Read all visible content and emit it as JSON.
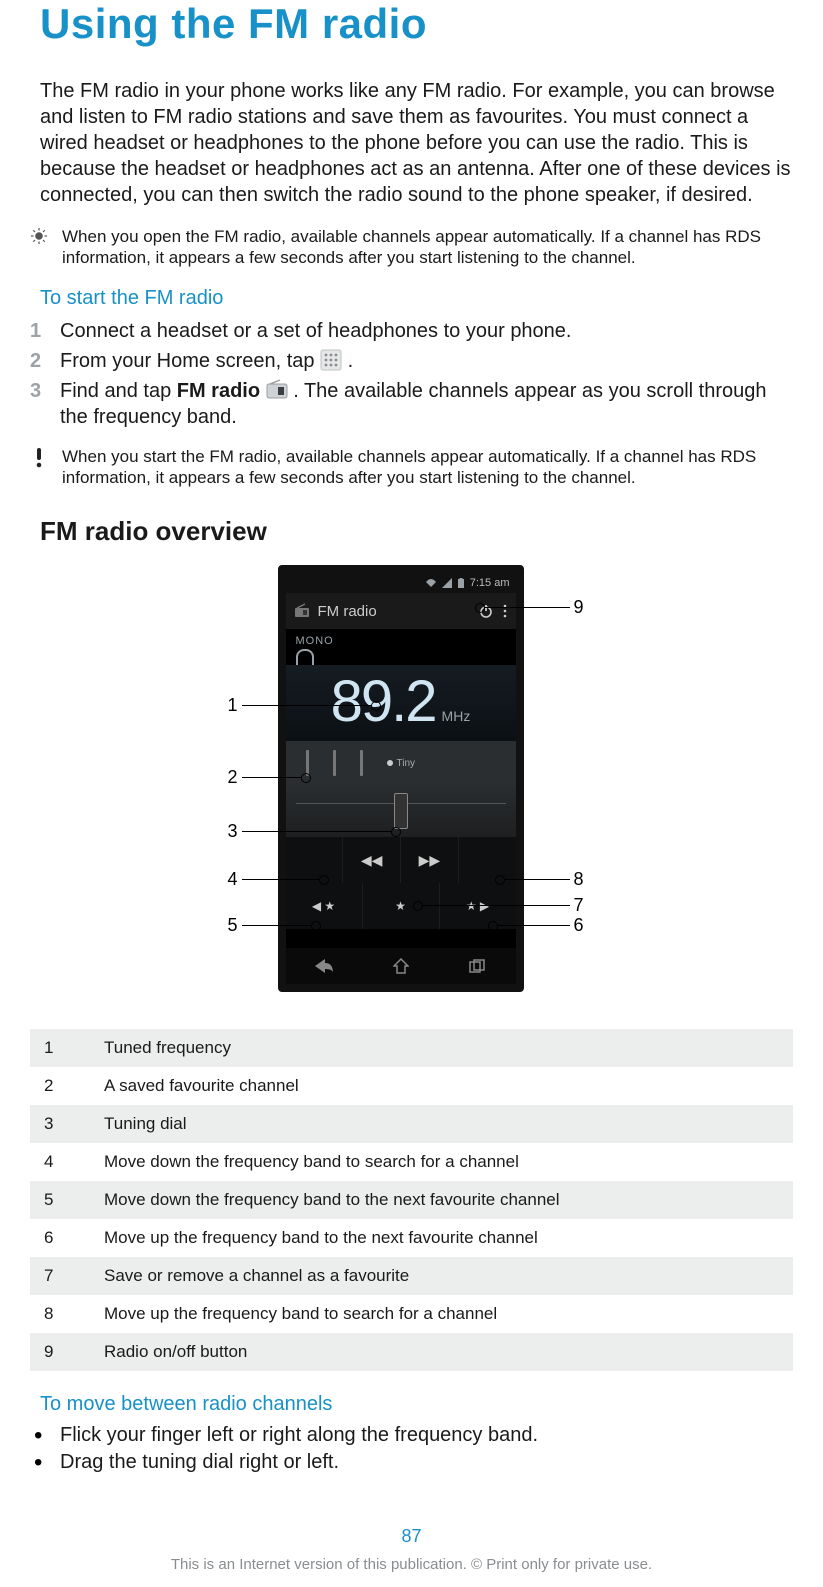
{
  "title": "Using the FM radio",
  "intro": "The FM radio in your phone works like any FM radio. For example, you can browse and listen to FM radio stations and save them as favourites. You must connect a wired headset or headphones to the phone before you can use the radio. This is because the headset or headphones act as an antenna. After one of these devices is connected, you can then switch the radio sound to the phone speaker, if desired.",
  "tip": "When you open the FM radio, available channels appear automatically. If a channel has RDS information, it appears a few seconds after you start listening to the channel.",
  "start_heading": "To start the FM radio",
  "steps": {
    "s1": "Connect a headset or a set of headphones to your phone.",
    "s2_a": "From your Home screen, tap ",
    "s2_b": " .",
    "s3_a": "Find and tap ",
    "s3_bold": "FM radio",
    "s3_b": " . The available channels appear as you scroll through the frequency band."
  },
  "important": "When you start the FM radio, available channels appear automatically. If a channel has RDS information, it appears a few seconds after you start listening to the channel.",
  "overview_heading": "FM radio overview",
  "phone": {
    "time": "7:15 am",
    "app_title": "FM radio",
    "mono": "MONO",
    "frequency": "89.2",
    "unit": "MHz",
    "fav_label": "Tiny"
  },
  "callouts": {
    "1": "1",
    "2": "2",
    "3": "3",
    "4": "4",
    "5": "5",
    "6": "6",
    "7": "7",
    "8": "8",
    "9": "9"
  },
  "overview_table": [
    {
      "n": "1",
      "t": "Tuned frequency"
    },
    {
      "n": "2",
      "t": "A saved favourite channel"
    },
    {
      "n": "3",
      "t": "Tuning dial"
    },
    {
      "n": "4",
      "t": "Move down the frequency band to search for a channel"
    },
    {
      "n": "5",
      "t": "Move down the frequency band to the next favourite channel"
    },
    {
      "n": "6",
      "t": "Move up the frequency band to the next favourite channel"
    },
    {
      "n": "7",
      "t": "Save or remove a channel as a favourite"
    },
    {
      "n": "8",
      "t": "Move up the frequency band to search for a channel"
    },
    {
      "n": "9",
      "t": "Radio on/off button"
    }
  ],
  "move_heading": "To move between radio channels",
  "bullets": {
    "b1": "Flick your finger left or right along the frequency band.",
    "b2": "Drag the tuning dial right or left."
  },
  "page_number": "87",
  "footer": "This is an Internet version of this publication. © Print only for private use."
}
